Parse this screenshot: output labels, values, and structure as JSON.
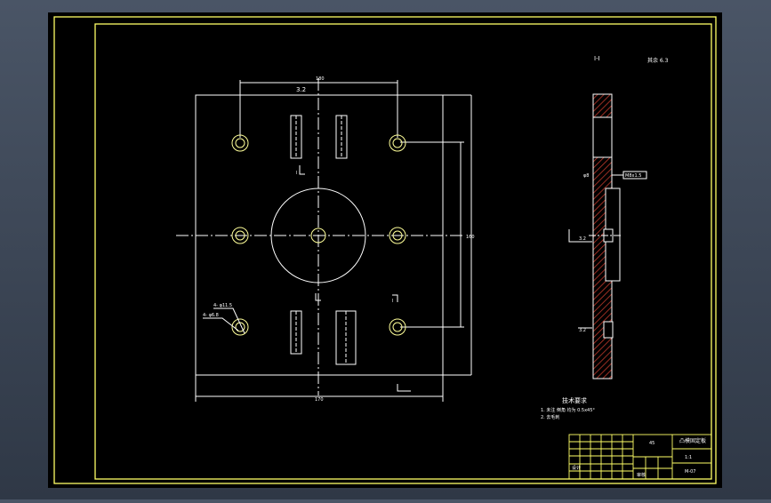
{
  "drawing": {
    "colors": {
      "viewport_bg": "#3e4857",
      "paper": "#000000",
      "frame": "#ffff66",
      "lines": "#ffffff",
      "centerlines": "#ffffff",
      "hatch": "#c0392b",
      "holes": "#ffff99",
      "dims": "#ffffff"
    },
    "section_label": "I-I",
    "roughness_note": "其余 6.3",
    "plan_dim_top": "180",
    "plan_dim_bottom": "170",
    "plan_dim_right": "160",
    "hole_note_1": "4- φ11.5",
    "hole_note_2": "4- φ6.8",
    "roughness_plan": "3.2",
    "section_mark_top": "I",
    "section_mark_bottom": "I",
    "side_dim_left": "φ8",
    "side_dim_upper": "M8x1.5",
    "side_dim_mid": "3.2",
    "side_dim_lower": "3.2",
    "notes_title": "技术要求",
    "notes_line1": "1. 未注 倒角 均为 0.5x45°",
    "notes_line2": "2. 去毛刺",
    "title_block": {
      "part_name": "凸模固定板",
      "material": "45",
      "scale": "1:1",
      "drawing_no": "M-07",
      "designer": "设计",
      "checker": "审核"
    }
  }
}
